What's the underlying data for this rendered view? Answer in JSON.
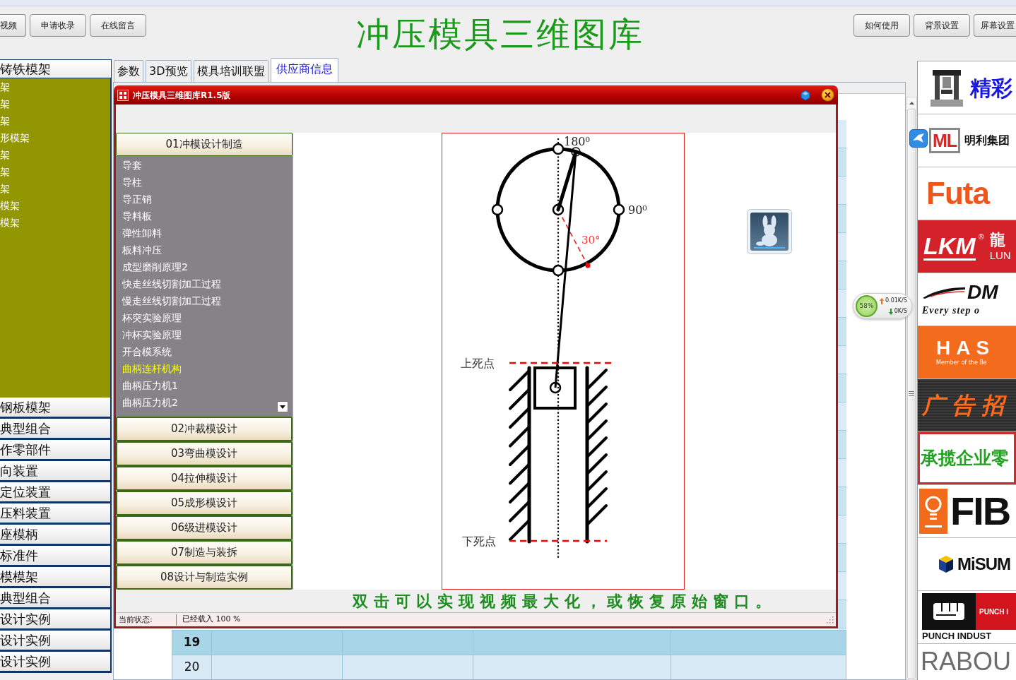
{
  "header": {
    "left_buttons": [
      "视频",
      "申请收录",
      "在线留言"
    ],
    "title": "冲压模具三维图库",
    "right_buttons": [
      "如何使用",
      "背景设置",
      "屏幕设置"
    ]
  },
  "sidebar": {
    "sections": [
      {
        "label": "铸铁模架",
        "expanded": true,
        "items": [
          "架",
          "架",
          "架",
          "形模架",
          "架",
          "架",
          "架",
          "模架",
          "模架"
        ]
      },
      {
        "label": "钢板模架",
        "expanded": false
      },
      {
        "label": "典型组合",
        "expanded": false
      },
      {
        "label": "作零部件",
        "expanded": false
      },
      {
        "label": "向装置",
        "expanded": false
      },
      {
        "label": "定位装置",
        "expanded": false
      },
      {
        "label": "压料装置",
        "expanded": false
      },
      {
        "label": "座模柄",
        "expanded": false
      },
      {
        "label": "标准件",
        "expanded": false
      },
      {
        "label": "模模架",
        "expanded": false
      },
      {
        "label": "典型组合",
        "expanded": false
      },
      {
        "label": "设计实例",
        "expanded": false
      },
      {
        "label": "设计实例",
        "expanded": false
      },
      {
        "label": "设计实例",
        "expanded": false
      }
    ]
  },
  "tabs": [
    {
      "label": "参数",
      "selected": false
    },
    {
      "label": "3D预览",
      "selected": false
    },
    {
      "label": "模具培训联盟",
      "selected": false
    },
    {
      "label": "供应商信息",
      "selected": true
    }
  ],
  "table": {
    "rows": [
      {
        "number": "19",
        "selected": true
      },
      {
        "number": "20",
        "selected": false
      }
    ]
  },
  "popup": {
    "title": "冲压模具三维图库R1.5版",
    "accordion": [
      {
        "label": "01冲模设计制造",
        "expanded": true,
        "items": [
          {
            "label": "导套",
            "selected": false
          },
          {
            "label": "导柱",
            "selected": false
          },
          {
            "label": "导正销",
            "selected": false
          },
          {
            "label": "导料板",
            "selected": false
          },
          {
            "label": "弹性卸料",
            "selected": false
          },
          {
            "label": "板料冲压",
            "selected": false
          },
          {
            "label": "成型磨削原理2",
            "selected": false
          },
          {
            "label": "快走丝线切割加工过程",
            "selected": false
          },
          {
            "label": "慢走丝线切割加工过程",
            "selected": false
          },
          {
            "label": "杯突实验原理",
            "selected": false
          },
          {
            "label": "冲杯实验原理",
            "selected": false
          },
          {
            "label": "开合模系统",
            "selected": false
          },
          {
            "label": "曲柄连杆机构",
            "selected": true
          },
          {
            "label": "曲柄压力机1",
            "selected": false
          },
          {
            "label": "曲柄压力机2",
            "selected": false
          }
        ]
      },
      {
        "label": "02冲裁模设计",
        "expanded": false
      },
      {
        "label": "03弯曲模设计",
        "expanded": false
      },
      {
        "label": "04拉伸模设计",
        "expanded": false
      },
      {
        "label": "05成形模设计",
        "expanded": false
      },
      {
        "label": "06级进模设计",
        "expanded": false
      },
      {
        "label": "07制造与装拆",
        "expanded": false
      },
      {
        "label": "08设计与制造实例",
        "expanded": false
      }
    ],
    "diagram": {
      "top_angle": "180⁰",
      "right_angle": "90⁰",
      "crank_angle": "30°",
      "top_dead_center": "上死点",
      "bottom_dead_center": "下死点"
    },
    "hint": "双击可以实现视频最大化，或恢复原始窗口。",
    "status_label": "当前状态:",
    "status_text": "已经载入 100 %"
  },
  "speed_widget": {
    "percent": "58%",
    "upload": "0.01K/S",
    "download": "0K/S"
  },
  "ads": [
    {
      "kind": "press-logo",
      "texts": [
        "精彩"
      ]
    },
    {
      "kind": "ml-logo",
      "texts": [
        "ML",
        "明利集团"
      ]
    },
    {
      "kind": "futa",
      "texts": [
        "Futa"
      ]
    },
    {
      "kind": "lkm",
      "texts": [
        "LKM",
        "®",
        "龍",
        "LUN"
      ]
    },
    {
      "kind": "dm",
      "texts": [
        "DM",
        "Every step o"
      ]
    },
    {
      "kind": "has",
      "texts": [
        "HAS",
        "Member of the Be"
      ]
    },
    {
      "kind": "dark-banner",
      "texts": [
        "广告招"
      ]
    },
    {
      "kind": "green-banner",
      "texts": [
        "承揽企业零"
      ]
    },
    {
      "kind": "fib",
      "texts": [
        "FIB"
      ]
    },
    {
      "kind": "misumi",
      "texts": [
        "MiSUM"
      ]
    },
    {
      "kind": "punch",
      "texts": [
        "PUNCH I",
        "PUNCH INDUST"
      ]
    },
    {
      "kind": "rabou",
      "texts": [
        "RABOU"
      ]
    }
  ]
}
